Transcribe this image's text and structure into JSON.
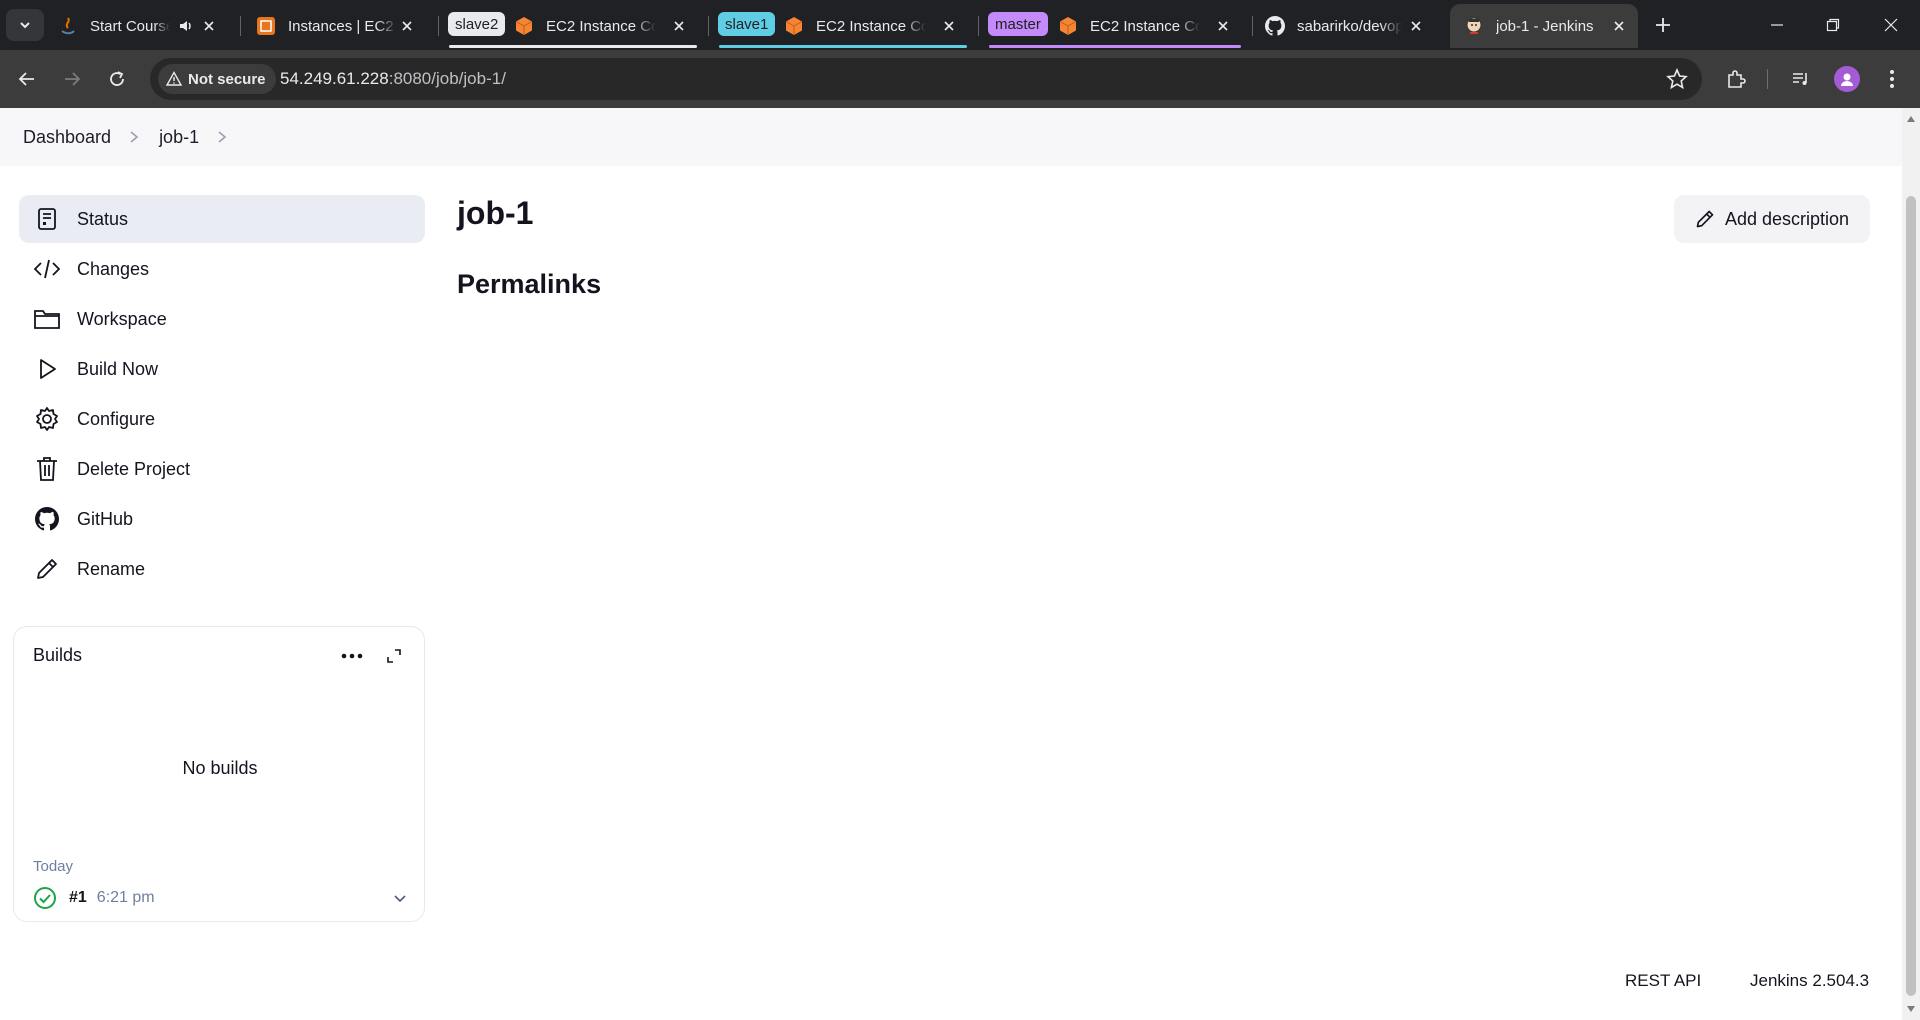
{
  "browser": {
    "tabs": [
      {
        "title": "Start Course",
        "favicon": "java-icon"
      },
      {
        "title": "Instances | EC2 |",
        "favicon": "aws-console-icon"
      },
      {
        "group": "slave2",
        "group_color": "#e8eaed",
        "title": "EC2 Instance Co",
        "favicon": "ec2-icon"
      },
      {
        "group": "slave1",
        "group_color": "#5fcde4",
        "title": "EC2 Instance Co",
        "favicon": "ec2-icon"
      },
      {
        "group": "master",
        "group_color": "#c58af9",
        "title": "EC2 Instance Co",
        "favicon": "ec2-icon"
      },
      {
        "title": "sabarirko/devop",
        "favicon": "github-icon"
      },
      {
        "title": "job-1 - Jenkins",
        "favicon": "jenkins-icon",
        "active": true
      }
    ],
    "security_label": "Not secure",
    "url_host": "54.249.61.228",
    "url_rest": ":8080/job/job-1/"
  },
  "breadcrumb": {
    "items": [
      "Dashboard",
      "job-1"
    ]
  },
  "sidebar": {
    "items": [
      {
        "label": "Status",
        "icon": "status-icon"
      },
      {
        "label": "Changes",
        "icon": "code-icon"
      },
      {
        "label": "Workspace",
        "icon": "folder-icon"
      },
      {
        "label": "Build Now",
        "icon": "play-icon"
      },
      {
        "label": "Configure",
        "icon": "gear-icon"
      },
      {
        "label": "Delete Project",
        "icon": "trash-icon"
      },
      {
        "label": "GitHub",
        "icon": "github-icon"
      },
      {
        "label": "Rename",
        "icon": "pencil-icon"
      }
    ]
  },
  "builds": {
    "title": "Builds",
    "empty_text": "No builds",
    "group_label": "Today",
    "entries": [
      {
        "number": "#1",
        "time": "6:21 pm",
        "status": "success"
      }
    ]
  },
  "main": {
    "title": "job-1",
    "permalinks_heading": "Permalinks",
    "add_description_label": "Add description"
  },
  "footer": {
    "rest_api": "REST API",
    "version": "Jenkins 2.504.3"
  },
  "colors": {
    "active_nav_bg": "#e9ecf3",
    "success_green": "#1ea446",
    "muted_text": "#6f7fa0"
  }
}
